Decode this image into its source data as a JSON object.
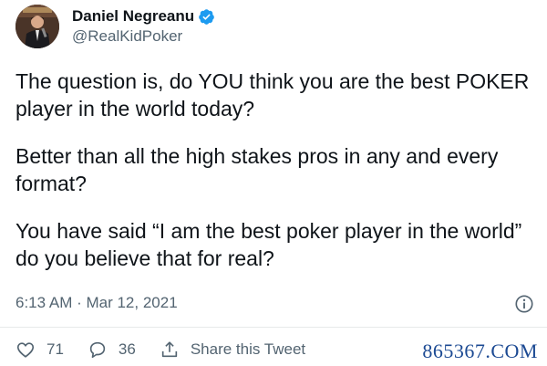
{
  "author": {
    "display_name": "Daniel Negreanu",
    "handle": "@RealKidPoker",
    "verified": true,
    "verified_color": "#1d9bf0"
  },
  "tweet": {
    "paragraphs": [
      "The question is, do YOU think you are the best POKER player in the world today?",
      "Better than all the high stakes pros in any and every format?",
      "You have said “I am the best poker player in the world” do you believe that for real?"
    ],
    "timestamp": "6:13 AM · Mar 12, 2021"
  },
  "actions": {
    "likes": "71",
    "replies": "36",
    "share_label": "Share this Tweet"
  },
  "icons": {
    "like": "heart-icon",
    "reply": "reply-bubble-icon",
    "share": "share-icon",
    "info": "info-icon",
    "verified": "verified-badge-icon"
  },
  "watermark": "865367.COM",
  "colors": {
    "text_primary": "#0f1419",
    "text_secondary": "#536471",
    "watermark": "#1c4a93"
  }
}
